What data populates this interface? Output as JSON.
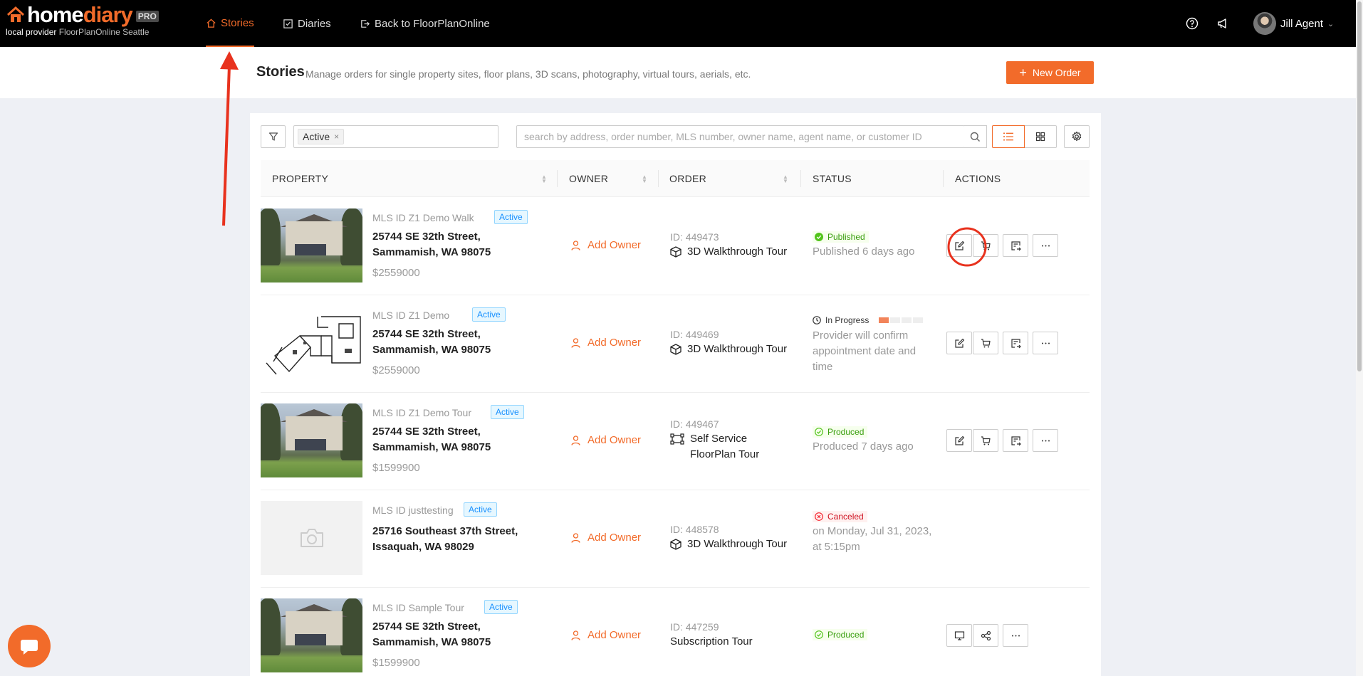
{
  "app": {
    "logo_word_white": "home",
    "logo_word_orange": "diary",
    "pro_badge": "PRO",
    "provider_prefix": "local provider",
    "provider_name": "FloorPlanOnline Seattle"
  },
  "nav": {
    "stories": "Stories",
    "diaries": "Diaries",
    "back": "Back to FloorPlanOnline"
  },
  "user": {
    "name": "Jill Agent"
  },
  "header": {
    "title": "Stories",
    "subtitle": "Manage orders for single property sites, floor plans, 3D scans, photography, virtual tours, aerials, etc.",
    "new_order": "New Order"
  },
  "filters": {
    "tag": "Active",
    "search_placeholder": "search by address, order number, MLS number, owner name, agent name, or customer ID"
  },
  "columns": {
    "property": "PROPERTY",
    "owner": "OWNER",
    "order": "ORDER",
    "status": "STATUS",
    "actions": "ACTIONS"
  },
  "rows": [
    {
      "mls": "MLS ID Z1 Demo Walk",
      "badge": "Active",
      "addr1": "25744 SE 32th Street,",
      "addr2": "Sammamish, WA 98075",
      "price": "$2559000",
      "owner": "Add Owner",
      "order_id": "ID: 449473",
      "order_type": "3D Walkthrough Tour",
      "status": "Published",
      "status_detail": "Published 6 days ago"
    },
    {
      "mls": "MLS ID Z1 Demo",
      "badge": "Active",
      "addr1": "25744 SE 32th Street,",
      "addr2": "Sammamish, WA 98075",
      "price": "$2559000",
      "owner": "Add Owner",
      "order_id": "ID: 449469",
      "order_type": "3D Walkthrough Tour",
      "status": "In Progress",
      "progress_fraction": 0.25,
      "status_detail": "Provider will confirm appointment date and time"
    },
    {
      "mls": "MLS ID Z1 Demo Tour",
      "badge": "Active",
      "addr1": "25744 SE 32th Street,",
      "addr2": "Sammamish, WA 98075",
      "price": "$1599900",
      "owner": "Add Owner",
      "order_id": "ID: 449467",
      "order_type_1": "Self Service",
      "order_type_2": "FloorPlan Tour",
      "status": "Produced",
      "status_detail": "Produced 7 days ago"
    },
    {
      "mls": "MLS ID justtesting",
      "badge": "Active",
      "addr1": "25716 Southeast 37th Street,",
      "addr2": "Issaquah, WA 98029",
      "owner": "Add Owner",
      "order_id": "ID: 448578",
      "order_type": "3D Walkthrough Tour",
      "status": "Canceled",
      "status_detail_1": "on Monday, Jul 31, 2023,",
      "status_detail_2": "at 5:15pm"
    },
    {
      "mls": "MLS ID Sample Tour",
      "badge": "Active",
      "addr1": "25744 SE 32th Street,",
      "addr2": "Sammamish, WA 98075",
      "price": "$1599900",
      "owner": "Add Owner",
      "order_id": "ID: 447259",
      "order_type": "Subscription Tour",
      "status": "Produced"
    }
  ],
  "colors": {
    "brand_orange": "#f26b2a",
    "annotation_red": "#e8321e",
    "active_badge_blue": "#1890ff",
    "success_green": "#52c41a",
    "error_red": "#f5222d"
  }
}
